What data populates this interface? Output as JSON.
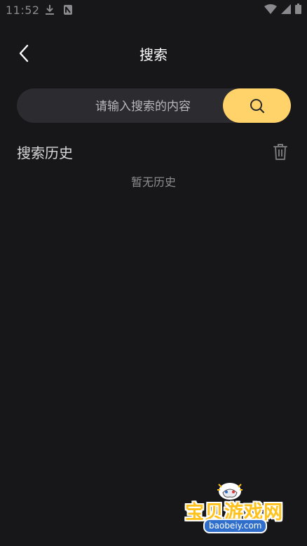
{
  "status_bar": {
    "time": "11:52",
    "left_icons": [
      "download-icon",
      "notification-icon"
    ],
    "right_icons": [
      "wifi-icon",
      "signal-icon",
      "battery-icon"
    ]
  },
  "header": {
    "title": "搜索",
    "back_icon": "back-arrow-icon"
  },
  "search": {
    "placeholder": "请输入搜索的内容",
    "value": "",
    "button_icon": "search-icon",
    "accent_color": "#ffd36a"
  },
  "history": {
    "title": "搜索历史",
    "clear_icon": "trash-icon",
    "empty_text": "暂无历史"
  },
  "watermark": {
    "title": "宝贝游戏网",
    "url": "baobeiy.com"
  },
  "colors": {
    "background": "#17171a",
    "search_bar": "#2b2b30",
    "accent": "#ffd36a"
  }
}
